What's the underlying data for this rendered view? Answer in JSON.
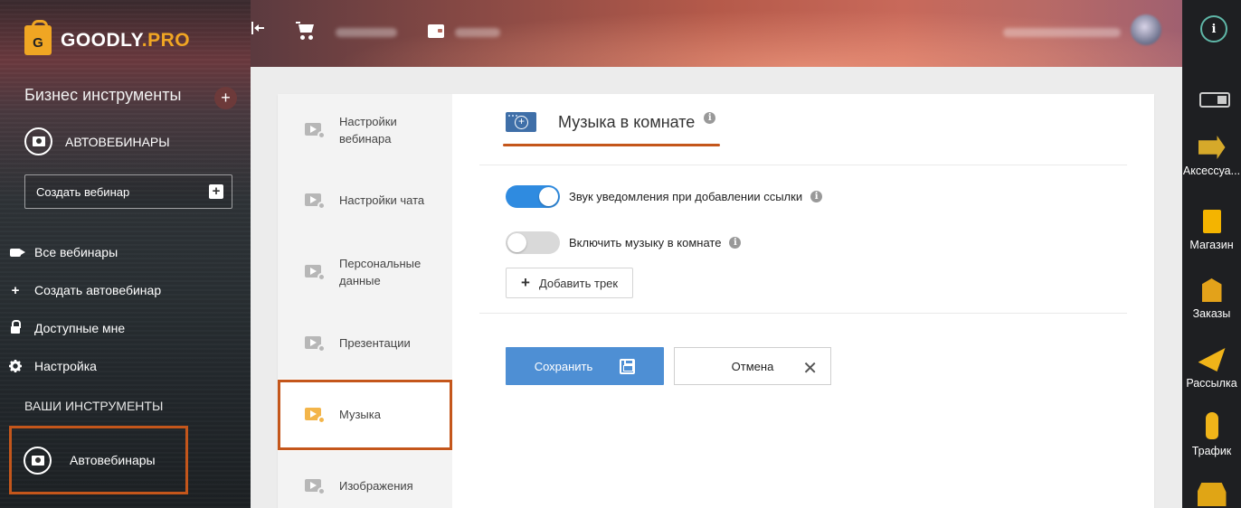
{
  "brand": {
    "name": "GOODLY",
    "suffix": ".PRO",
    "mark": "G"
  },
  "sidebar": {
    "section_title": "Бизнес инструменты",
    "add_label": "+",
    "module_title": "АВТОВЕБИНАРЫ",
    "create_webinar": "Создать вебинар",
    "create_plus": "+",
    "items": [
      {
        "label": "Все вебинары",
        "icon": "video-camera-icon"
      },
      {
        "label": "Создать автовебинар",
        "icon": "plus-icon"
      },
      {
        "label": "Доступные мне",
        "icon": "lock-icon"
      },
      {
        "label": "Настройка",
        "icon": "gear-icon"
      }
    ],
    "tools_title": "ВАШИ ИНСТРУМЕНТЫ",
    "tool_item": "Автовебинары"
  },
  "topbar": {
    "collapse_icon": "collapse-sidebar-icon",
    "cart_icon": "cart-icon",
    "wallet_icon": "wallet-icon",
    "plus_glyph": "+"
  },
  "rail": {
    "info_glyph": "i",
    "items": [
      {
        "label": "Аксессуа...",
        "icon": "accessories-icon"
      },
      {
        "label": "Магазин",
        "icon": "shopping-bag-icon"
      },
      {
        "label": "Заказы",
        "icon": "orders-box-icon"
      },
      {
        "label": "Рассылка",
        "icon": "paper-plane-icon"
      },
      {
        "label": "Трафик",
        "icon": "mouse-icon"
      }
    ]
  },
  "tabs": [
    {
      "label": "Настройки вебинара"
    },
    {
      "label": "Настройки чата"
    },
    {
      "label": "Персональные данные"
    },
    {
      "label": "Презентации"
    },
    {
      "label": "Музыка",
      "active": true
    },
    {
      "label": "Изображения"
    }
  ],
  "section": {
    "title": "Музыка в комнате",
    "info_glyph": "i",
    "notification_sound": {
      "label": "Звук уведомления при добавлении ссылки",
      "enabled": true
    },
    "room_music": {
      "label": "Включить музыку в комнате",
      "enabled": false
    },
    "add_track_plus": "+",
    "add_track": "Добавить трек",
    "save": "Сохранить",
    "cancel": "Отмена",
    "cancel_glyph": "✕"
  },
  "colors": {
    "accent": "#4e8fd4",
    "toggle_on": "#2f8be0",
    "brand": "#f0a623",
    "highlight": "#c4561b"
  }
}
